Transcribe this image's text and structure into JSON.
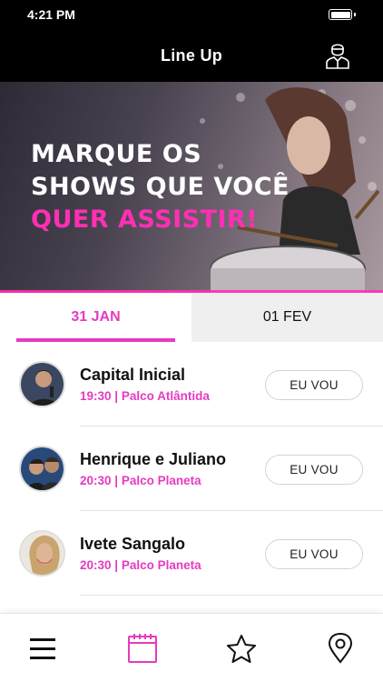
{
  "status_bar": {
    "time": "4:21 PM"
  },
  "header": {
    "title": "Line Up"
  },
  "hero": {
    "line1": "MARQUE OS",
    "line2": "SHOWS QUE VOCÊ",
    "line3": "QUER ASSISTIR!"
  },
  "tabs": [
    {
      "label": "31 JAN",
      "active": true
    },
    {
      "label": "01 FEV",
      "active": false
    }
  ],
  "shows": [
    {
      "artist": "Capital Inicial",
      "time": "19:30",
      "separator": "|",
      "stage": "Palco Atlântida",
      "action": "EU VOU"
    },
    {
      "artist": "Henrique e Juliano",
      "time": "20:30",
      "separator": "|",
      "stage": "Palco Planeta",
      "action": "EU VOU"
    },
    {
      "artist": "Ivete Sangalo",
      "time": "20:30",
      "separator": "|",
      "stage": "Palco Planeta",
      "action": "EU VOU"
    }
  ],
  "bottom_nav": [
    {
      "icon": "menu-icon"
    },
    {
      "icon": "calendar-icon",
      "active": true
    },
    {
      "icon": "star-icon"
    },
    {
      "icon": "map-pin-icon"
    }
  ],
  "colors": {
    "accent": "#e63ac0",
    "bar": "#000000"
  }
}
